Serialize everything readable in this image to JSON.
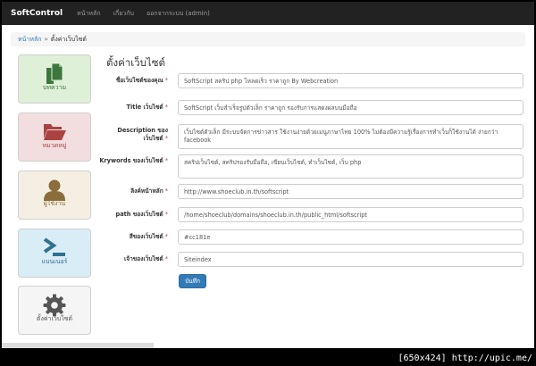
{
  "navbar": {
    "brand": "SoftControl",
    "links": [
      "หน้าหลัก",
      "เกี่ยวกับ",
      "ออกจากระบบ (admin)"
    ]
  },
  "breadcrumb": {
    "home": "หน้าหลัก",
    "separator": "»",
    "current": "ตั้งค่าเว็บไซต์"
  },
  "sidebar": {
    "tiles": [
      {
        "label": "บทความ",
        "icon": "files-icon",
        "color": "#3c763d"
      },
      {
        "label": "หมวดหมู่",
        "icon": "folder-open-icon",
        "color": "#a94442"
      },
      {
        "label": "ผู้ใช้งาน",
        "icon": "user-icon",
        "color": "#8a6d3b"
      },
      {
        "label": "แบนเนอร์",
        "icon": "terminal-icon",
        "color": "#31708f"
      },
      {
        "label": "ตั้งค่าเว็บไซต์",
        "icon": "gear-icon",
        "color": "#555555"
      }
    ]
  },
  "form": {
    "title": "ตั้งค่าเว็บไซต์",
    "fields": [
      {
        "label": "ชื่อเว็บไซต์ของคุณ",
        "required": true,
        "value": "SoftScript สคริป php โหลดเร็ว ราคาถูก By Webcreation"
      },
      {
        "label": "Title เว็บไซต์",
        "required": true,
        "value": "SoftScript เว็บสำเร็จรูปตัวเล็ก ราคาถูก รองรับการแสดงผลบนมือถือ"
      },
      {
        "label": "Description ของเว็บไซต์",
        "required": true,
        "value": "เว็บไซต์ตัวเล็ก มีระบบจัดการข่าวสาร ใช้งานง่ายด้วยเมนูภาษาไทย 100% ไม่ต้องมีความรู้เรื่องการทำเว็บก็ใช้งานได้ ง่ายกว่า facebook"
      },
      {
        "label": "Krywords ของเว็บไซต์",
        "required": true,
        "value": "สคริปเว็บไซต์, สคริปรองรับมือถือ, เขียนเว็บไซต์, ทำเว็บไซต์, เว็บ php"
      },
      {
        "label": "ลิงค์หน้าหลัก",
        "required": true,
        "value": "http://www.shoeclub.in.th/softscript"
      },
      {
        "label": "path ของเว็บไซต์",
        "required": true,
        "value": "/home/shoeclub/domains/shoeclub.in.th/public_html/softscript"
      },
      {
        "label": "สีของเว็บไซต์",
        "required": true,
        "value": "#cc181e"
      },
      {
        "label": "เจ้าของเว็บไซต์",
        "required": true,
        "value": "Siteindex"
      }
    ],
    "submit_label": "บันทึก"
  },
  "watermark": "[650x424] http://upic.me/",
  "colors": {
    "navbar_bg": "#222222",
    "primary": "#337ab7",
    "required_mark": "#a94442"
  }
}
